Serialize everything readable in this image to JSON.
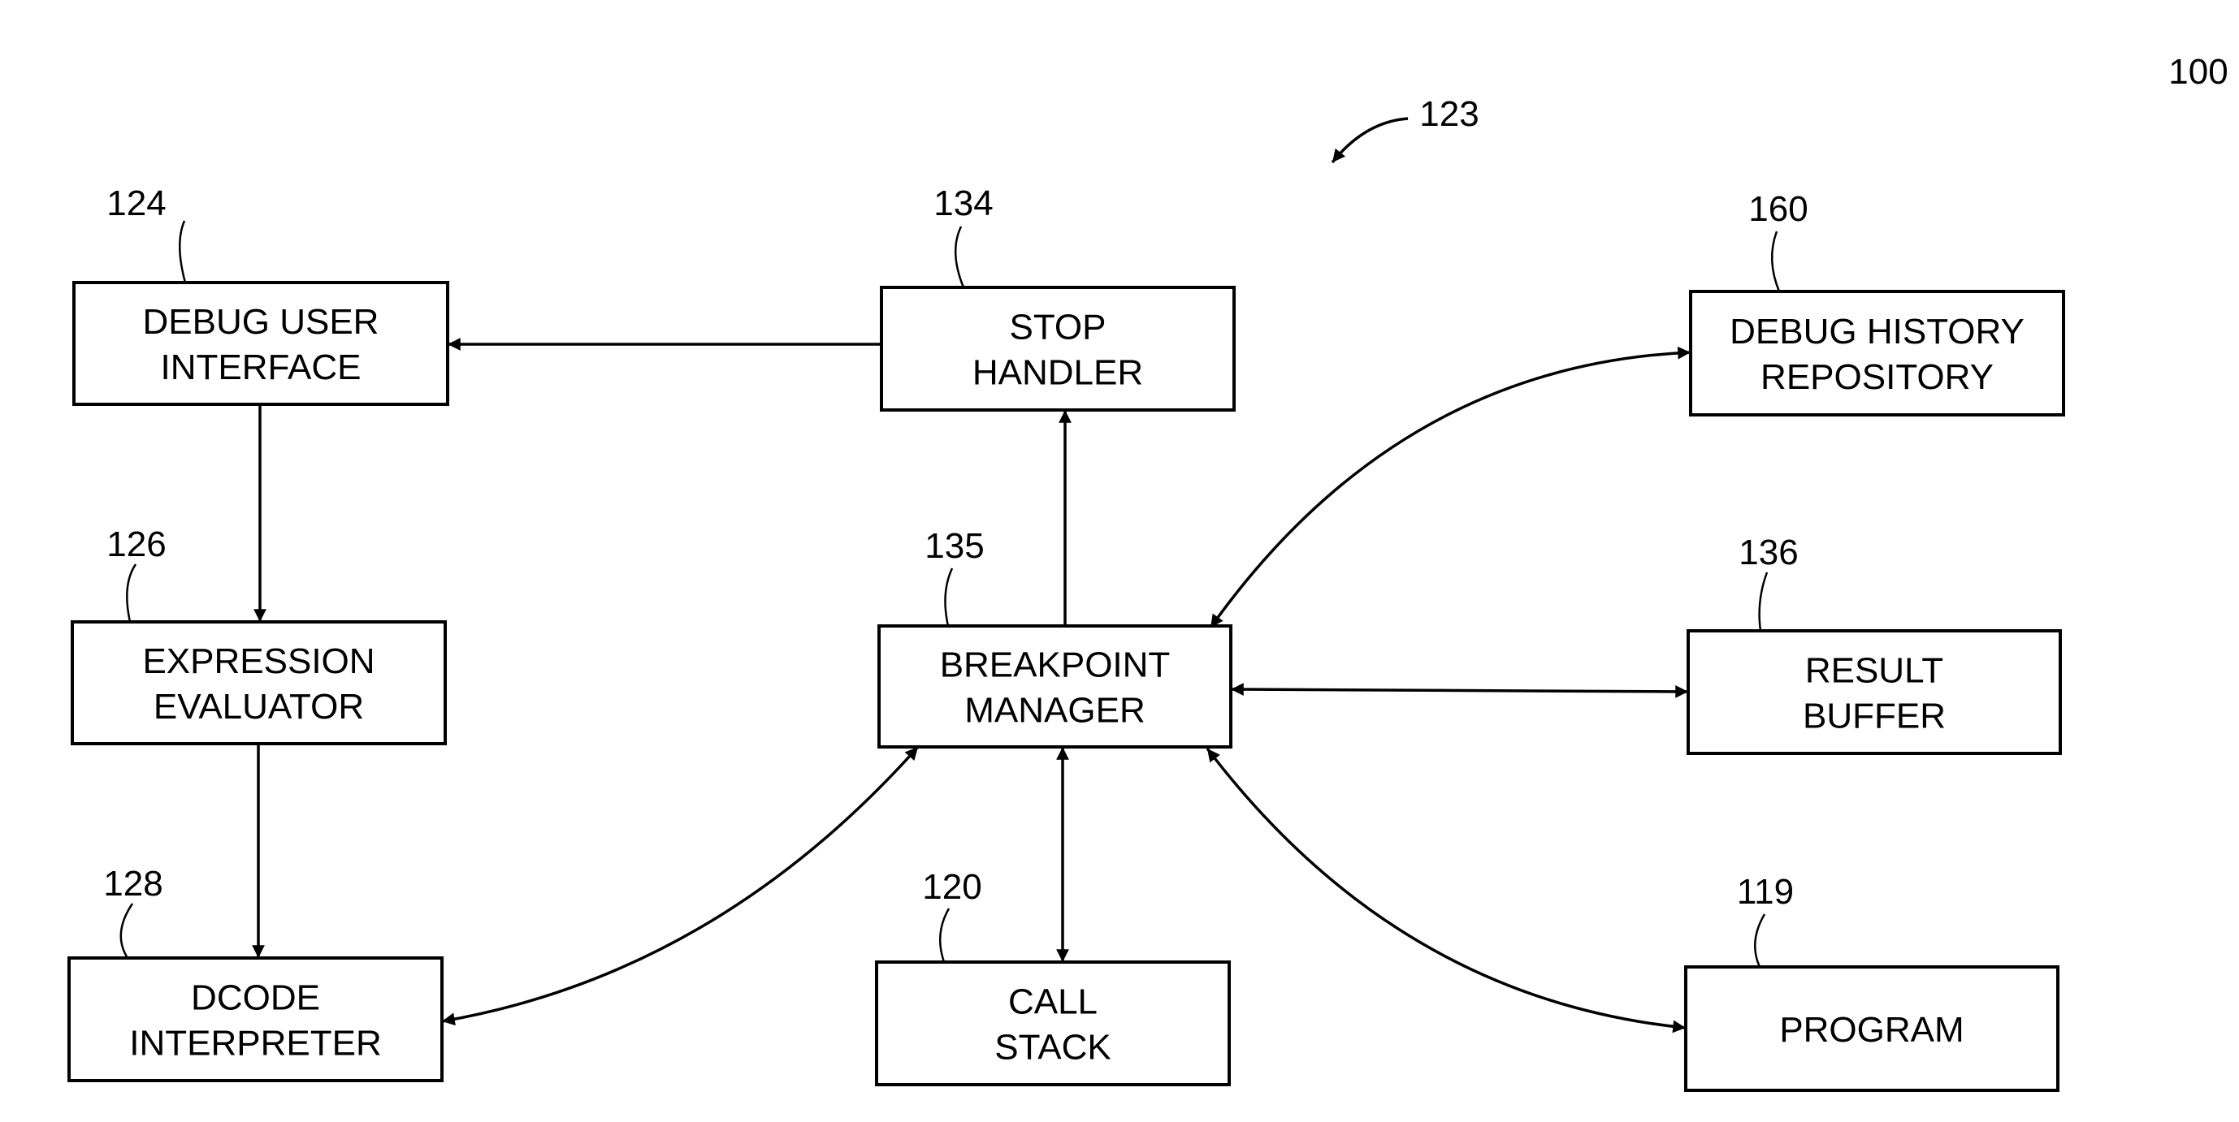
{
  "figure": {
    "figure_ref": "100",
    "system_ref": "123",
    "colors": {
      "ink": "#000000",
      "background": "#ffffff"
    }
  },
  "boxes": [
    {
      "id": "debug-user-interface",
      "ref": "124",
      "lines": [
        "DEBUG USER",
        "INTERFACE"
      ]
    },
    {
      "id": "stop-handler",
      "ref": "134",
      "lines": [
        "STOP",
        "HANDLER"
      ]
    },
    {
      "id": "debug-history-repository",
      "ref": "160",
      "lines": [
        "DEBUG HISTORY",
        "REPOSITORY"
      ]
    },
    {
      "id": "expression-evaluator",
      "ref": "126",
      "lines": [
        "EXPRESSION",
        "EVALUATOR"
      ]
    },
    {
      "id": "breakpoint-manager",
      "ref": "135",
      "lines": [
        "BREAKPOINT",
        "MANAGER"
      ]
    },
    {
      "id": "result-buffer",
      "ref": "136",
      "lines": [
        "RESULT",
        "BUFFER"
      ]
    },
    {
      "id": "dcode-interpreter",
      "ref": "128",
      "lines": [
        "DCODE",
        "INTERPRETER"
      ]
    },
    {
      "id": "call-stack",
      "ref": "120",
      "lines": [
        "CALL",
        "STACK"
      ]
    },
    {
      "id": "program",
      "ref": "119",
      "lines": [
        "PROGRAM"
      ]
    }
  ],
  "connections": [
    {
      "from": "stop-handler",
      "to": "debug-user-interface",
      "direction": "one-way"
    },
    {
      "from": "debug-user-interface",
      "to": "expression-evaluator",
      "direction": "one-way"
    },
    {
      "from": "expression-evaluator",
      "to": "dcode-interpreter",
      "direction": "one-way"
    },
    {
      "from": "breakpoint-manager",
      "to": "stop-handler",
      "direction": "one-way"
    },
    {
      "from": "breakpoint-manager",
      "to": "debug-history-repository",
      "direction": "two-way"
    },
    {
      "from": "breakpoint-manager",
      "to": "result-buffer",
      "direction": "two-way"
    },
    {
      "from": "breakpoint-manager",
      "to": "call-stack",
      "direction": "two-way"
    },
    {
      "from": "breakpoint-manager",
      "to": "program",
      "direction": "two-way"
    },
    {
      "from": "breakpoint-manager",
      "to": "dcode-interpreter",
      "direction": "two-way"
    }
  ]
}
